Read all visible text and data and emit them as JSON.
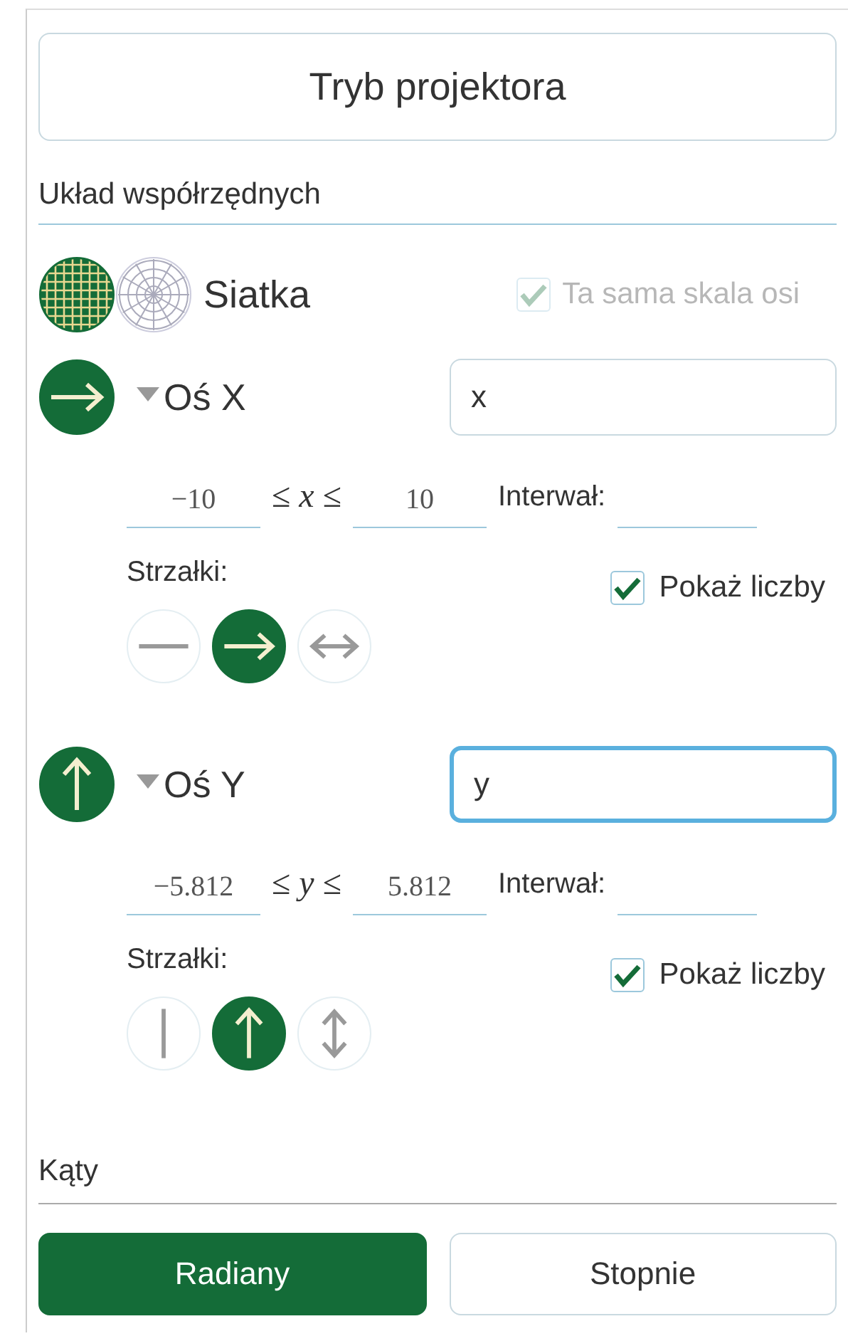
{
  "projector_button": "Tryb projektora",
  "section_title": "Układ współrzędnych",
  "grid": {
    "label": "Siatka",
    "options": [
      {
        "kind": "cartesian",
        "selected": true
      },
      {
        "kind": "polar",
        "selected": false
      }
    ],
    "same_scale": {
      "label": "Ta sama skala osi",
      "checked": true,
      "disabled": true
    }
  },
  "axes": [
    {
      "kind": "horizontal",
      "on": true,
      "expanded": true,
      "label": "Oś X",
      "name_value": "x",
      "focused": false,
      "min": "−10",
      "relation": "≤ *x* ≤",
      "max": "10",
      "interval_label": "Interwał:",
      "arrows_label": "Strzałki:",
      "arrow_options": [
        {
          "kind": "none",
          "selected": false
        },
        {
          "kind": "positive",
          "selected": true
        },
        {
          "kind": "both",
          "selected": false
        }
      ],
      "show_numbers": {
        "label": "Pokaż liczby",
        "checked": true
      }
    },
    {
      "kind": "vertical",
      "on": true,
      "expanded": true,
      "label": "Oś Y",
      "name_value": "y",
      "focused": true,
      "min": "−5.812",
      "relation": "≤ *y* ≤",
      "max": "5.812",
      "interval_label": "Interwał:",
      "arrows_label": "Strzałki:",
      "arrow_options": [
        {
          "kind": "none",
          "selected": false
        },
        {
          "kind": "positive",
          "selected": true
        },
        {
          "kind": "both",
          "selected": false
        }
      ],
      "show_numbers": {
        "label": "Pokaż liczby",
        "checked": true
      }
    }
  ],
  "angles": {
    "label": "Kąty",
    "options": [
      {
        "label": "Radiany",
        "selected": true
      },
      {
        "label": "Stopnie",
        "selected": false
      }
    ]
  }
}
